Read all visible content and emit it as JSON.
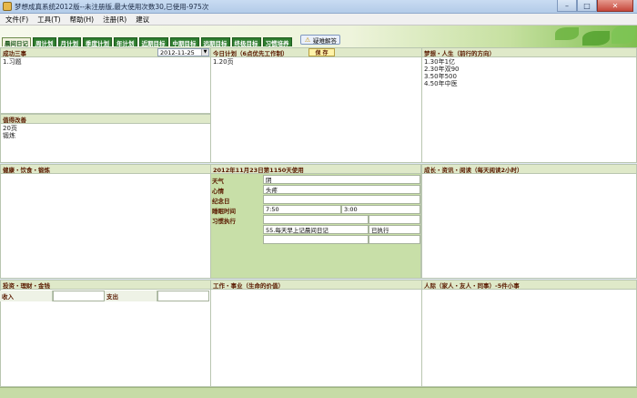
{
  "window": {
    "title": "梦想成真系统2012版--未注册版,最大使用次数30,已使用-975次"
  },
  "menu": [
    "文件(F)",
    "工具(T)",
    "帮助(H)",
    "注册(R)",
    "建议"
  ],
  "tabs": [
    "晨间日记",
    "周计划",
    "月计划",
    "季度计划",
    "年计划",
    "近期目标",
    "中期目标",
    "远期目标",
    "终极目标",
    "习惯培养"
  ],
  "tip_button": "疑难解答",
  "date_picker": {
    "value": "2012-11-25"
  },
  "save_button": "保 存",
  "panels": {
    "success": {
      "title": "成功三事",
      "lines": [
        "1.习题"
      ]
    },
    "today_plan": {
      "title": "今日计划（6点优先工作制）",
      "lines": [
        "1.20页"
      ]
    },
    "dream": {
      "title": "梦想・人生（前行的方向）",
      "lines": [
        "1.30年1亿",
        "2.30年双90",
        "3.50年500",
        "4.50年中医"
      ]
    },
    "improve": {
      "title": "值得改善",
      "lines": [
        "20页",
        "锻炼"
      ]
    },
    "health": {
      "title": "健康・饮食・锻炼"
    },
    "day_info": {
      "title": "2012年11月23日第1150天使用"
    },
    "growth": {
      "title": "成长・资讯・阅读（每天阅读2小时）"
    },
    "invest": {
      "title": "投资・理财・金钱"
    },
    "work": {
      "title": "工作・事业（生命的价值）"
    },
    "people": {
      "title": "人际（家人・友人・同事）-5件小事"
    }
  },
  "day_fields": {
    "weather_label": "天气",
    "weather_value": "阴",
    "mood_label": "心情",
    "mood_value": "头疼",
    "memorial_label": "纪念日",
    "sleep_label": "睡眠时间",
    "sleep_start": "7:50",
    "sleep_end": "3:00",
    "habit_label": "习惯执行",
    "habit_item": "55.每天早上记晨间日记",
    "habit_status": "已执行"
  },
  "ledger": {
    "income_label": "收入",
    "expense_label": "支出"
  }
}
